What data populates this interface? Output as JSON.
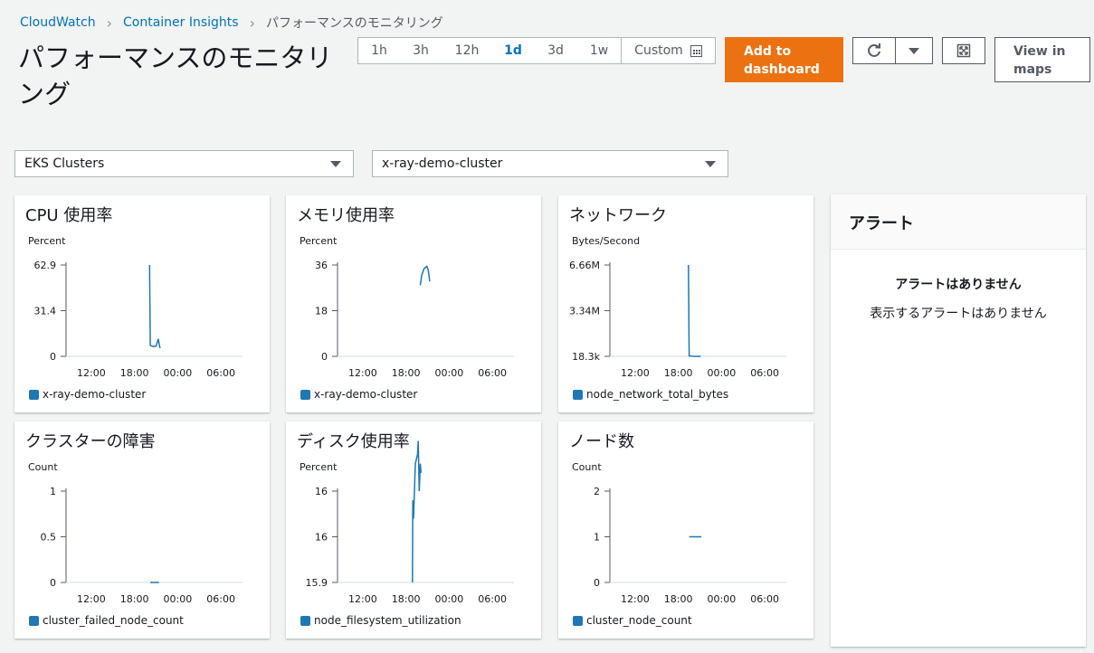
{
  "breadcrumb": {
    "items": [
      {
        "label": "CloudWatch"
      },
      {
        "label": "Container Insights"
      },
      {
        "label": "パフォーマンスのモニタリング"
      }
    ]
  },
  "page": {
    "title": "パフォーマンスのモニタリング"
  },
  "toolbar": {
    "ranges": [
      {
        "label": "1h"
      },
      {
        "label": "3h"
      },
      {
        "label": "12h"
      },
      {
        "label": "1d",
        "active": true
      },
      {
        "label": "3d"
      },
      {
        "label": "1w"
      }
    ],
    "custom_label": "Custom",
    "add_dashboard_label": "Add to dashboard",
    "refresh_icon": "refresh-icon",
    "dropdown_icon": "caret-down-icon",
    "fullscreen_icon": "expand-icon",
    "view_maps_label": "View in maps",
    "accent_color": "#ec7211"
  },
  "filters": {
    "resource_type": "EKS Clusters",
    "cluster": "x-ray-demo-cluster"
  },
  "alerts": {
    "title": "アラート",
    "empty_title": "アラートはありません",
    "empty_text": "表示するアラートはありません"
  },
  "chart_data": [
    {
      "type": "line",
      "title": "CPU 使用率",
      "ylabel": "Percent",
      "y_ticks": [
        "62.9",
        "31.4",
        "0"
      ],
      "ylim": [
        0,
        62.9
      ],
      "x_ticks": [
        "12:00",
        "18:00",
        "00:00",
        "06:00"
      ],
      "series": [
        {
          "name": "x-ray-demo-cluster",
          "color": "#1f77b4",
          "points": [
            [
              20.1,
              62.9
            ],
            [
              20.2,
              7.5
            ],
            [
              20.6,
              6.8
            ],
            [
              21.0,
              7.0
            ],
            [
              21.3,
              12.0
            ],
            [
              21.5,
              6.5
            ],
            [
              21.6,
              5.8
            ]
          ]
        }
      ]
    },
    {
      "type": "line",
      "title": "メモリ使用率",
      "ylabel": "Percent",
      "y_ticks": [
        "36",
        "18",
        "0"
      ],
      "ylim": [
        0,
        36
      ],
      "x_ticks": [
        "12:00",
        "18:00",
        "00:00",
        "06:00"
      ],
      "series": [
        {
          "name": "x-ray-demo-cluster",
          "color": "#1f77b4",
          "points": [
            [
              20.0,
              28.0
            ],
            [
              20.2,
              32.0
            ],
            [
              20.5,
              34.5
            ],
            [
              20.9,
              35.5
            ],
            [
              21.1,
              34.0
            ],
            [
              21.3,
              29.5
            ]
          ]
        }
      ]
    },
    {
      "type": "line",
      "title": "ネットワーク",
      "ylabel": "Bytes/Second",
      "y_ticks": [
        "6.66M",
        "3.34M",
        "18.3k"
      ],
      "ylim": [
        0.0183,
        6.66
      ],
      "x_ticks": [
        "12:00",
        "18:00",
        "00:00",
        "06:00"
      ],
      "series": [
        {
          "name": "node_network_total_bytes",
          "color": "#1f77b4",
          "points": [
            [
              19.4,
              6.66
            ],
            [
              19.5,
              0.05
            ],
            [
              19.8,
              0.03
            ],
            [
              20.4,
              0.02
            ],
            [
              21.1,
              0.02
            ]
          ]
        }
      ]
    },
    {
      "type": "line",
      "title": "クラスターの障害",
      "ylabel": "Count",
      "y_ticks": [
        "1",
        "0.5",
        "0"
      ],
      "ylim": [
        0,
        1
      ],
      "x_ticks": [
        "12:00",
        "18:00",
        "00:00",
        "06:00"
      ],
      "series": [
        {
          "name": "cluster_failed_node_count",
          "color": "#1f77b4",
          "points": [
            [
              20.2,
              0
            ],
            [
              21.4,
              0
            ]
          ]
        }
      ]
    },
    {
      "type": "line",
      "title": "ディスク使用率",
      "ylabel": "Percent",
      "y_ticks": [
        "16",
        "16",
        "15.9"
      ],
      "ylim": [
        15.9,
        16.0
      ],
      "x_ticks": [
        "12:00",
        "18:00",
        "00:00",
        "06:00"
      ],
      "series": [
        {
          "name": "node_filesystem_utilization",
          "color": "#1f77b4",
          "points": [
            [
              18.9,
              15.9
            ],
            [
              18.95,
              15.99
            ],
            [
              19.05,
              15.97
            ],
            [
              19.3,
              16.03
            ],
            [
              19.6,
              16.04
            ],
            [
              19.7,
              16.055
            ],
            [
              19.85,
              16.0
            ],
            [
              20.0,
              16.03
            ],
            [
              20.1,
              16.02
            ]
          ]
        }
      ]
    },
    {
      "type": "line",
      "title": "ノード数",
      "ylabel": "Count",
      "y_ticks": [
        "2",
        "1",
        "0"
      ],
      "ylim": [
        0,
        2
      ],
      "x_ticks": [
        "12:00",
        "18:00",
        "00:00",
        "06:00"
      ],
      "series": [
        {
          "name": "cluster_node_count",
          "color": "#1f77b4",
          "points": [
            [
              19.5,
              1
            ],
            [
              21.2,
              1
            ]
          ]
        }
      ]
    }
  ]
}
